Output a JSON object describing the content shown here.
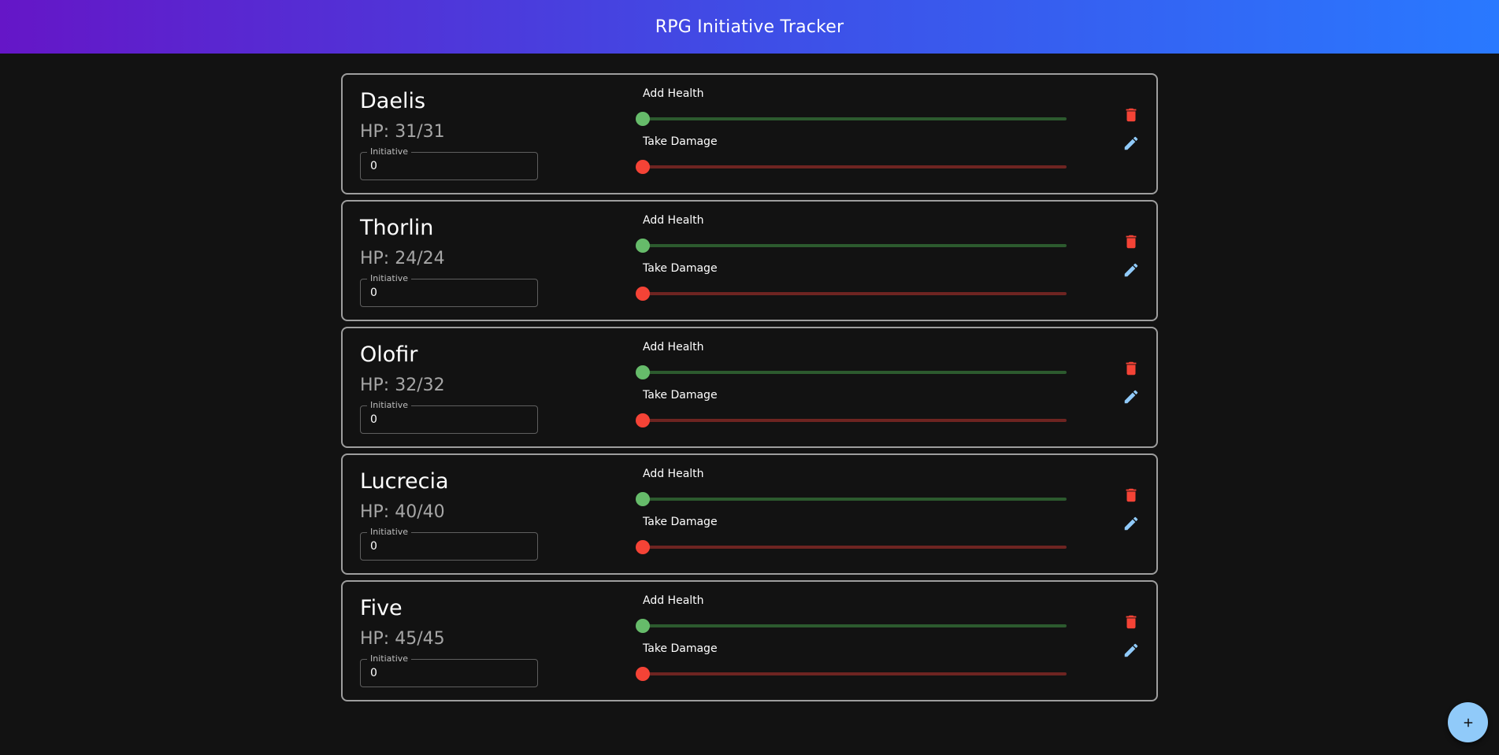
{
  "app": {
    "title": "RPG Initiative Tracker"
  },
  "labels": {
    "initiative": "Initiative",
    "add_health": "Add Health",
    "take_damage": "Take Damage"
  },
  "characters": [
    {
      "name": "Daelis",
      "hp": "HP: 31/31",
      "initiative": "0",
      "heal_value": 0,
      "damage_value": 0
    },
    {
      "name": "Thorlin",
      "hp": "HP: 24/24",
      "initiative": "0",
      "heal_value": 0,
      "damage_value": 0
    },
    {
      "name": "Olofir",
      "hp": "HP: 32/32",
      "initiative": "0",
      "heal_value": 0,
      "damage_value": 0
    },
    {
      "name": "Lucrecia",
      "hp": "HP: 40/40",
      "initiative": "0",
      "heal_value": 0,
      "damage_value": 0
    },
    {
      "name": "Five",
      "hp": "HP: 45/45",
      "initiative": "0",
      "heal_value": 0,
      "damage_value": 0
    }
  ],
  "icons": {
    "delete": "trash-icon",
    "edit": "pencil-icon",
    "add": "plus-icon"
  },
  "colors": {
    "header_gradient_start": "#6516c7",
    "header_gradient_end": "#2979ff",
    "background": "#121212",
    "heal_thumb": "#66bb6a",
    "heal_track": "#2c5a2e",
    "damage_thumb": "#f44336",
    "damage_track": "#6e2421",
    "delete_icon": "#f44336",
    "edit_icon": "#90caf9",
    "fab": "#90caf9"
  }
}
